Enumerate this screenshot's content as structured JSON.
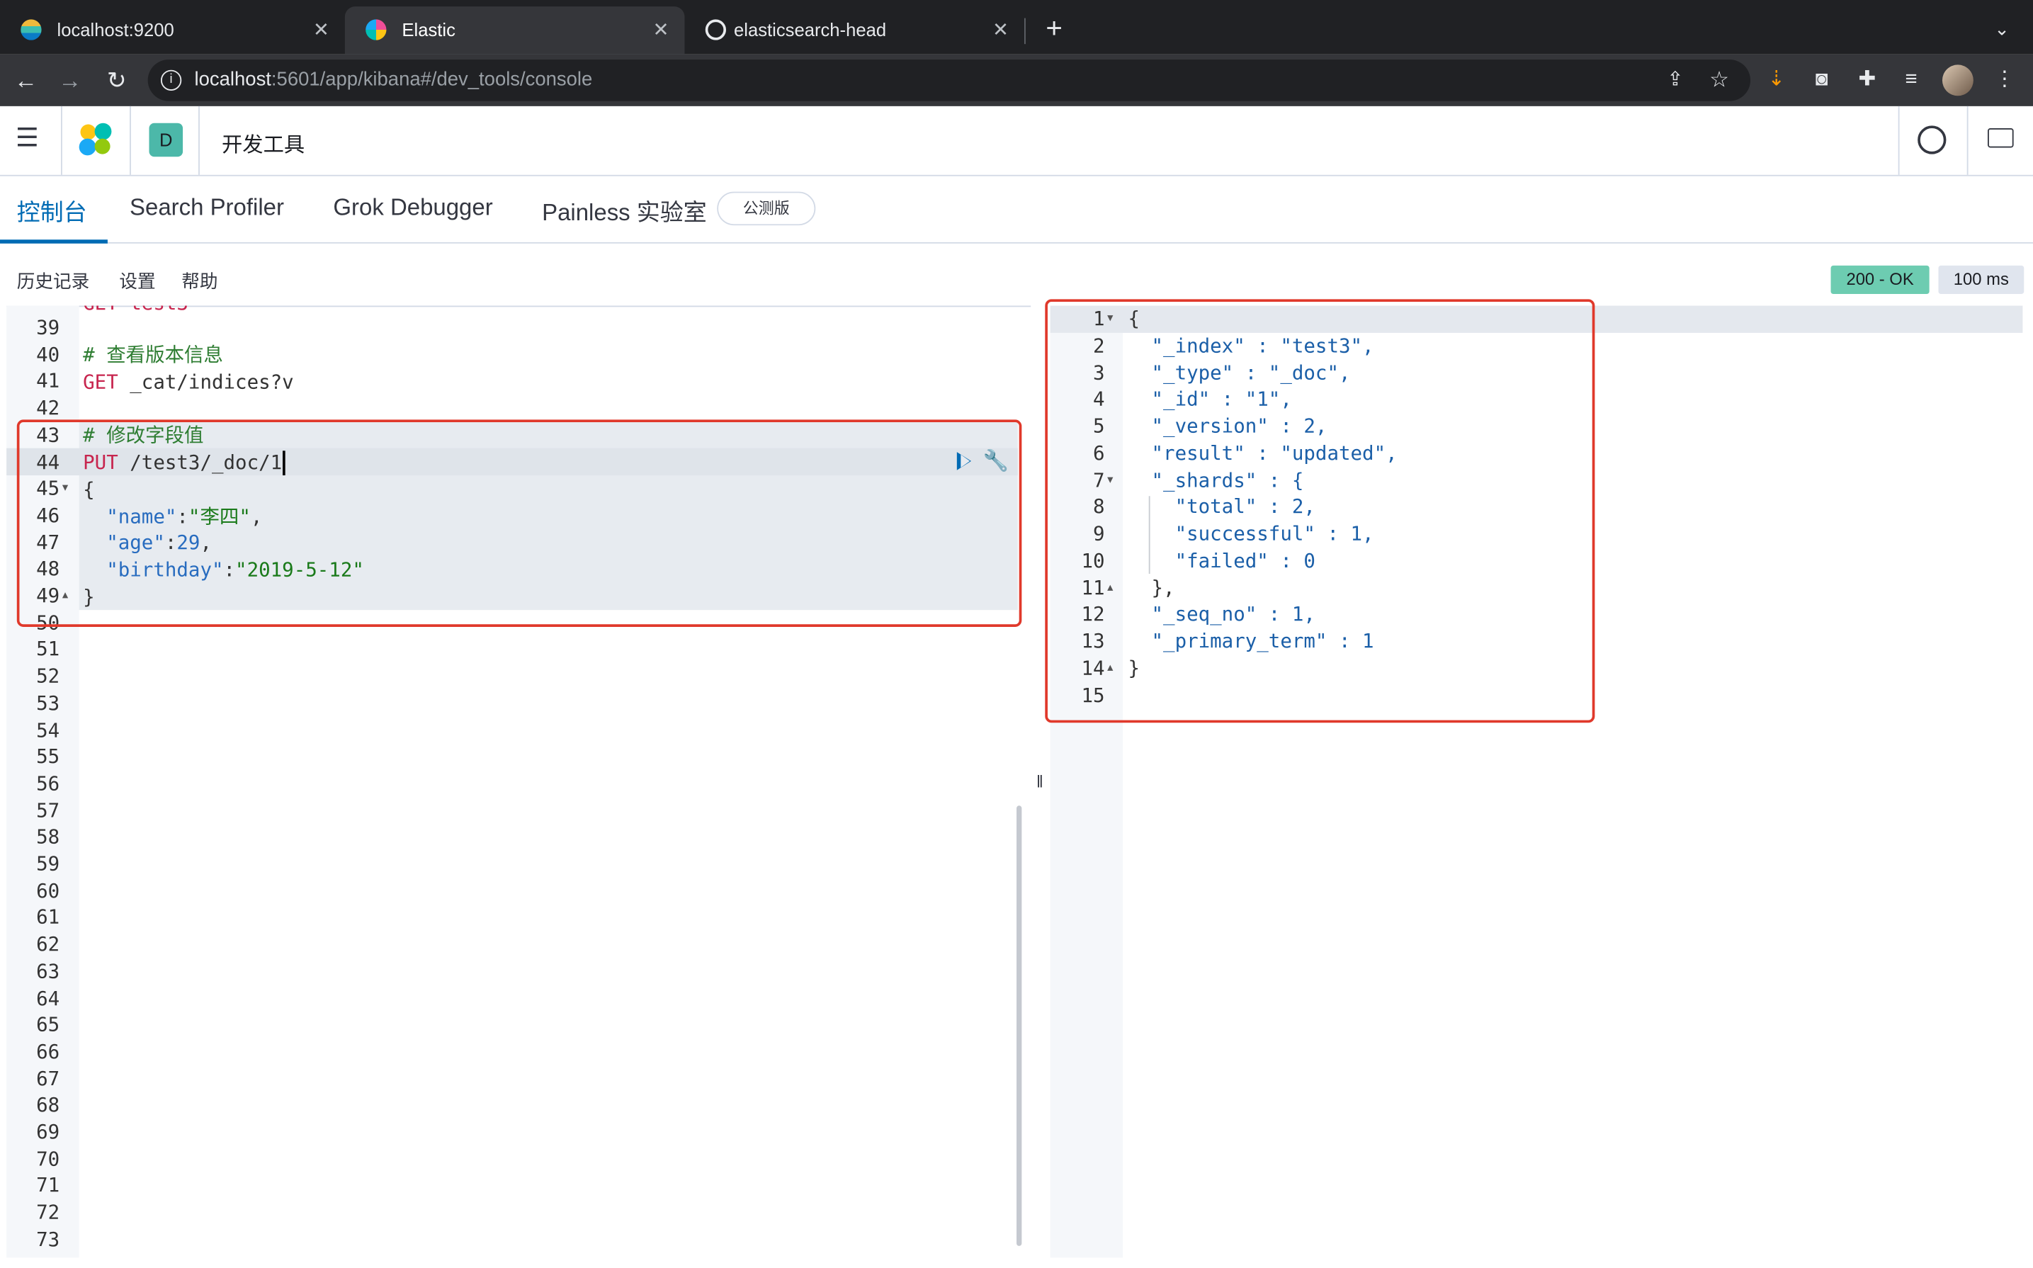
{
  "browser": {
    "tabs": [
      {
        "title": "localhost:9200",
        "active": false
      },
      {
        "title": "Elastic",
        "active": true
      },
      {
        "title": "elasticsearch-head",
        "active": false
      }
    ],
    "url_host": "localhost",
    "url_rest": ":5601/app/kibana#/dev_tools/console"
  },
  "kibana": {
    "space_initial": "D",
    "app_title": "开发工具",
    "tabs": [
      "控制台",
      "Search Profiler",
      "Grok Debugger",
      "Painless 实验室"
    ],
    "beta_badge": "公测版",
    "menu": [
      "历史记录",
      "设置",
      "帮助"
    ],
    "status_ok": "200 - OK",
    "status_time": "100 ms"
  },
  "request_editor": {
    "line_numbers": [
      "39",
      "40",
      "41",
      "42",
      "43",
      "44",
      "45",
      "46",
      "47",
      "48",
      "49",
      "50",
      "51",
      "52",
      "53",
      "54",
      "55",
      "56",
      "57",
      "58",
      "59",
      "60",
      "61",
      "62",
      "63",
      "64",
      "65",
      "66",
      "67",
      "68",
      "69",
      "70",
      "71",
      "72",
      "73"
    ],
    "lines": {
      "l40": "# 查看版本信息",
      "l41_method": "GET",
      "l41_path": " _cat/indices?v",
      "l43": "# 修改字段值",
      "l44_method": "PUT",
      "l44_path": " /test3/_doc/1",
      "l45": "{",
      "l46_key": "\"name\"",
      "l46_val": "\"李四\"",
      "l47_key": "\"age\"",
      "l47_val": "29",
      "l48_key": "\"birthday\"",
      "l48_val": "\"2019-5-12\"",
      "l49": "}"
    }
  },
  "response_editor": {
    "line_numbers": [
      "1",
      "2",
      "3",
      "4",
      "5",
      "6",
      "7",
      "8",
      "9",
      "10",
      "11",
      "12",
      "13",
      "14",
      "15"
    ],
    "lines": [
      "{",
      "  \"_index\" : \"test3\",",
      "  \"_type\" : \"_doc\",",
      "  \"_id\" : \"1\",",
      "  \"_version\" : 2,",
      "  \"result\" : \"updated\",",
      "  \"_shards\" : {",
      "    \"total\" : 2,",
      "    \"successful\" : 1,",
      "    \"failed\" : 0",
      "  },",
      "  \"_seq_no\" : 1,",
      "  \"_primary_term\" : 1",
      "}",
      ""
    ]
  },
  "colors": {
    "accent": "#006bb4",
    "ok": "#6dccb1",
    "highlight": "#e0392b"
  }
}
